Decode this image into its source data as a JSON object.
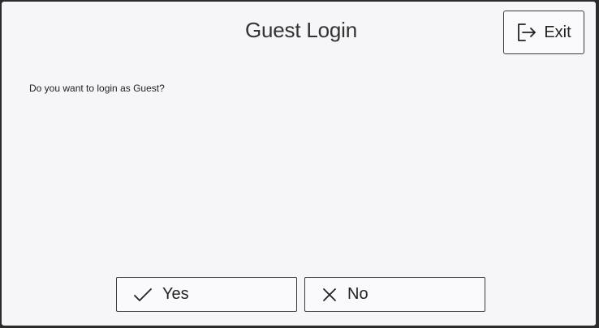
{
  "dialog": {
    "title": "Guest Login",
    "message": "Do you want to login as Guest?"
  },
  "header": {
    "exit_label": "Exit",
    "exit_icon": "logout-icon"
  },
  "actions": {
    "yes_label": "Yes",
    "yes_icon": "checkmark-icon",
    "no_label": "No",
    "no_icon": "close-icon"
  }
}
